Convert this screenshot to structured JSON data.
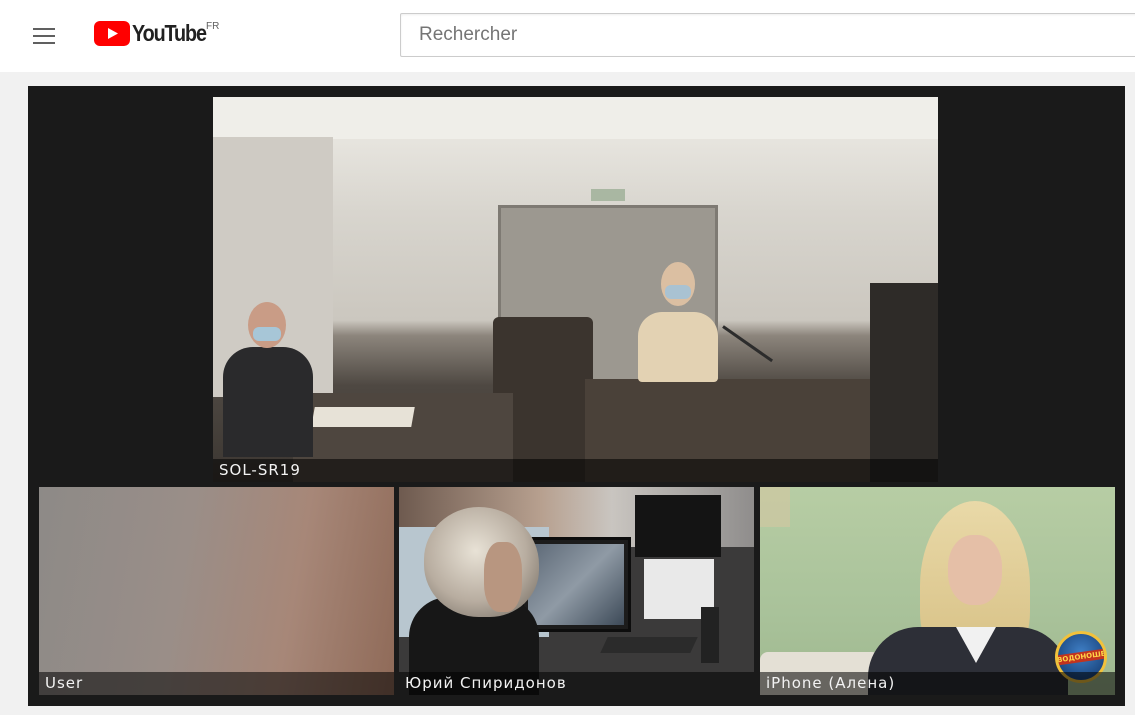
{
  "masthead": {
    "logo_text": "YouTube",
    "region": "FR",
    "search_placeholder": "Rechercher",
    "icons": {
      "menu": "hamburger-menu-icon",
      "play": "youtube-play-icon"
    },
    "colors": {
      "brand_red": "#ff0000",
      "text": "#212121"
    }
  },
  "video": {
    "participants": [
      {
        "label": "SOL-SR19"
      },
      {
        "label": "User"
      },
      {
        "label": "Юрий Спиридонов"
      },
      {
        "label": "iPhone (Алена)"
      }
    ],
    "channel_badge_text": "ВОДОНОШЕ"
  }
}
